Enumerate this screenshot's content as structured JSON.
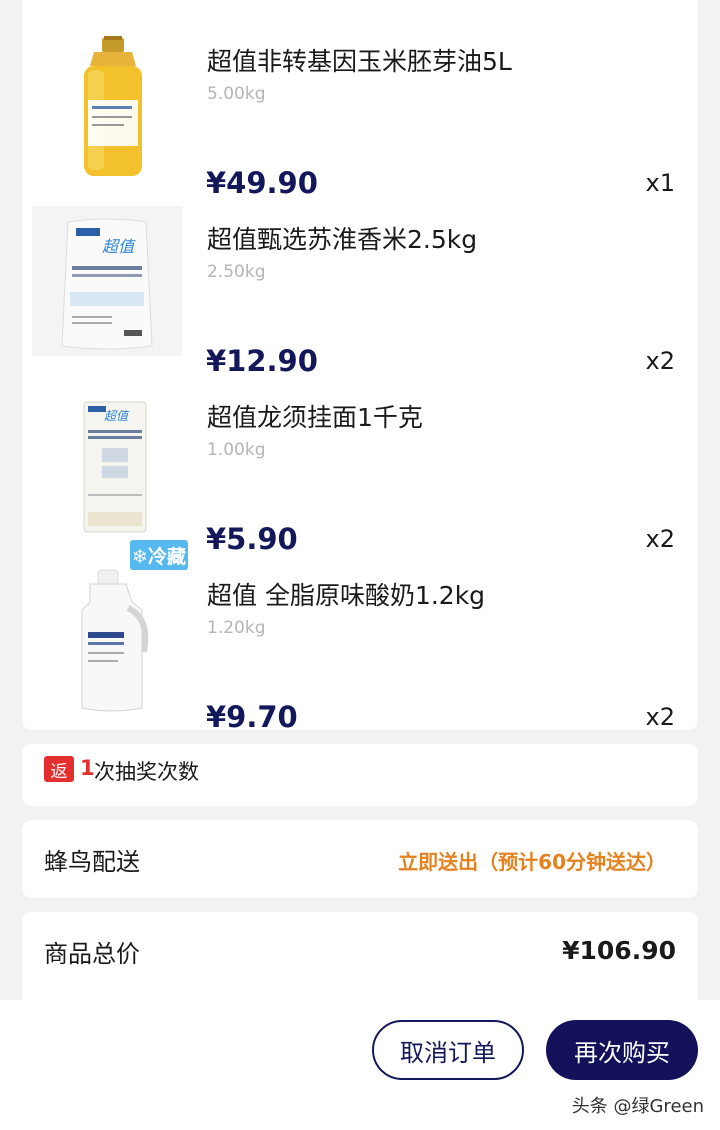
{
  "items": [
    {
      "name": "超值非转基因玉米胚芽油5L",
      "spec": "5.00kg",
      "price": "¥49.90",
      "qty": "x1"
    },
    {
      "name": "超值甄选苏淮香米2.5kg",
      "spec": "2.50kg",
      "price": "¥12.90",
      "qty": "x2"
    },
    {
      "name": "超值龙须挂面1千克",
      "spec": "1.00kg",
      "price": "¥5.90",
      "qty": "x2"
    },
    {
      "name": "超值 全脂原味酸奶1.2kg",
      "spec": "1.20kg",
      "price": "¥9.70",
      "qty": "x2",
      "badge": "❄冷藏"
    }
  ],
  "lottery": {
    "badge": "返",
    "count": "1",
    "text": "次抽奖次数"
  },
  "delivery": {
    "label": "蜂鸟配送",
    "status": "立即送出（预计60分钟送达）"
  },
  "total": {
    "label": "商品总价",
    "value": "¥106.90"
  },
  "actions": {
    "cancel": "取消订单",
    "rebuy": "再次购买"
  },
  "watermark": "头条 @绿Green",
  "colors": {
    "navy": "#12185a",
    "orange": "#e6821e",
    "red": "#e52e2e",
    "cold_blue": "#55b8ee"
  }
}
